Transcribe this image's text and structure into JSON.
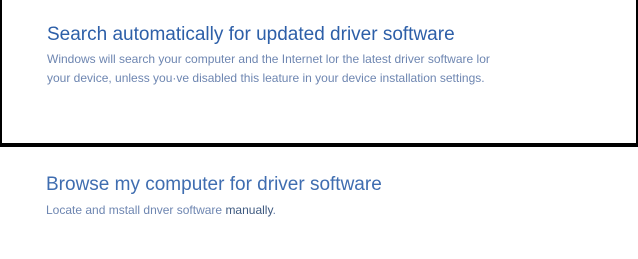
{
  "options": [
    {
      "title": "Search automatically for updated driver software",
      "description_line1": "Windows will search your computer and the Internet lor  the latest driver software lor",
      "description_line2": "your device, unless you·ve disabled this leature in your device installation settings."
    },
    {
      "title": "Browse my computer for driver software",
      "description_prefix": "Locate and mstall dnver software ",
      "description_emphasis": "manually",
      "description_suffix": "."
    }
  ]
}
